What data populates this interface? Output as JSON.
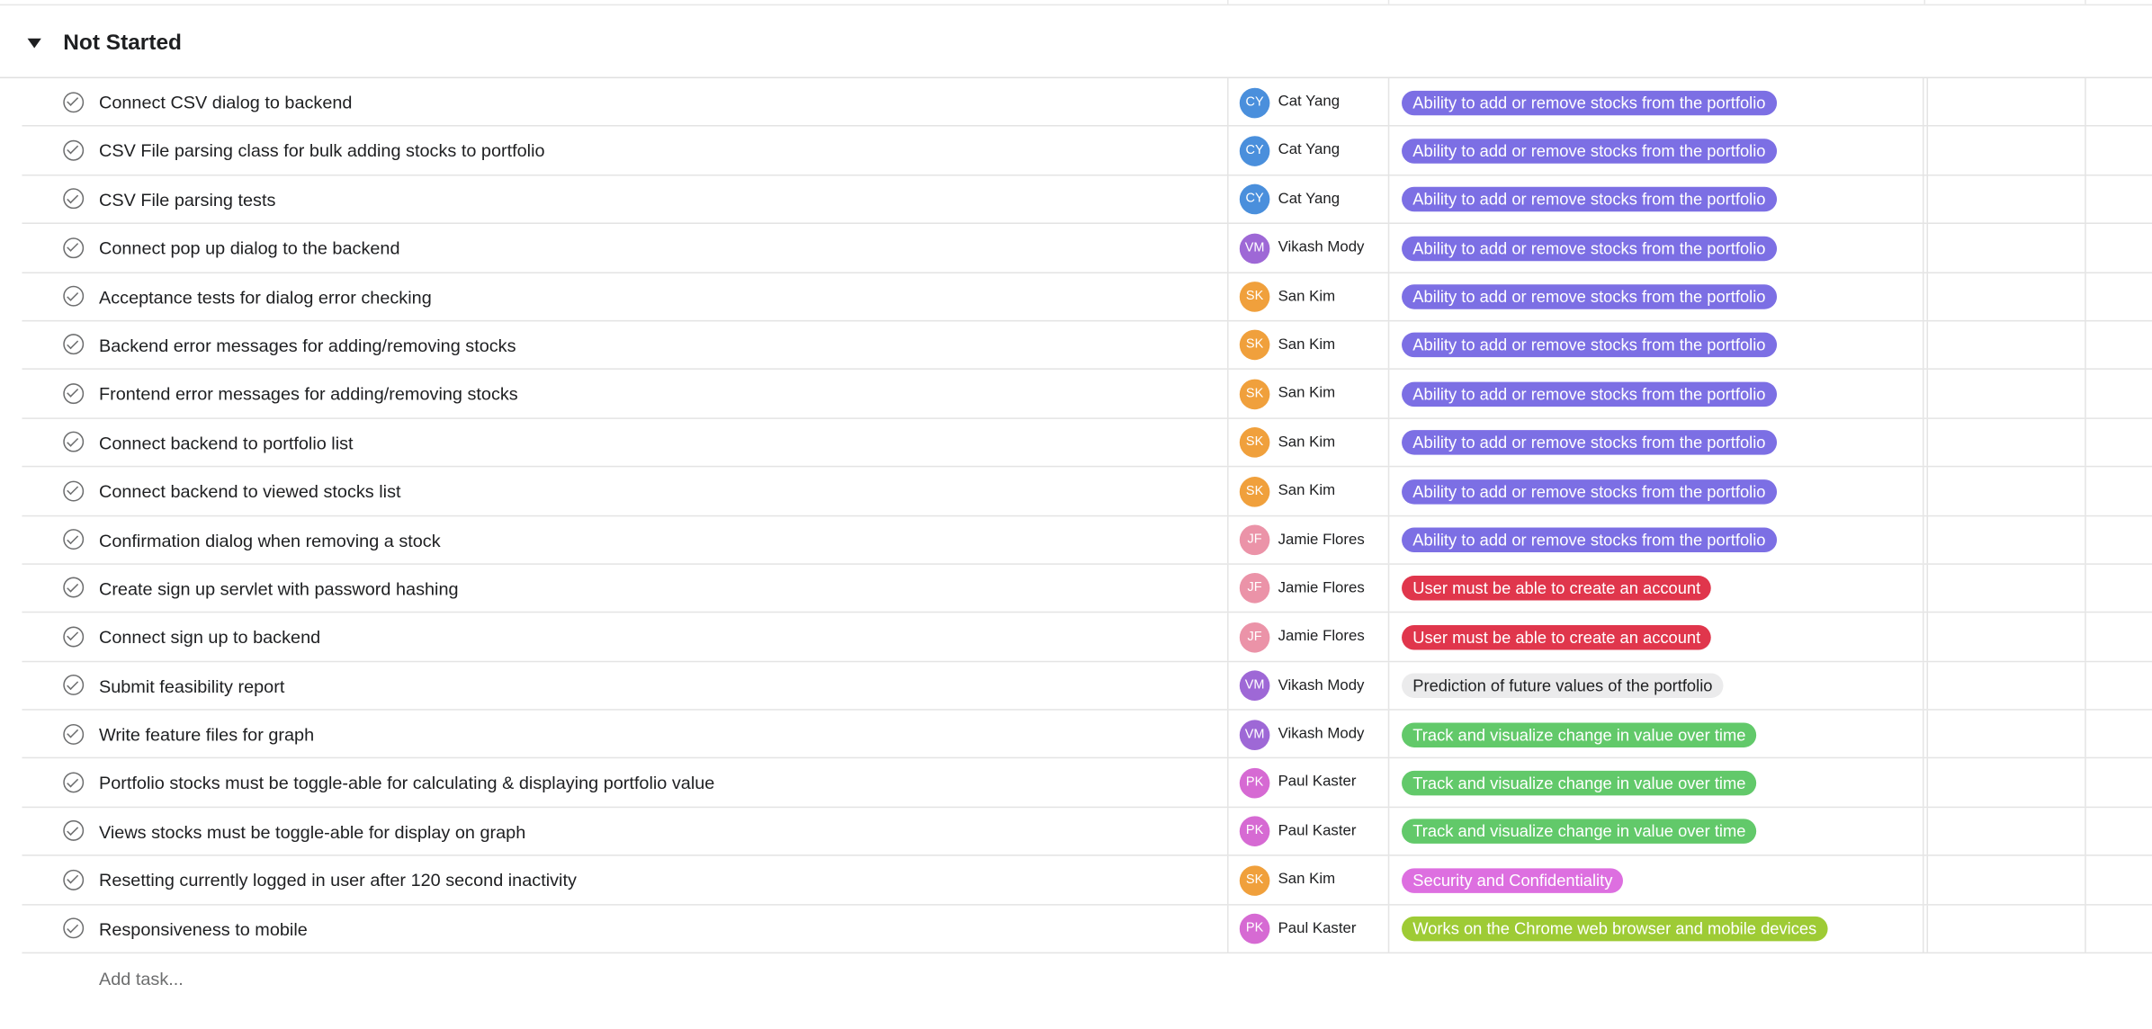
{
  "section": {
    "title": "Not Started"
  },
  "colors": {
    "avatar_cy": "#4a8fdc",
    "avatar_vm": "#9e68d6",
    "avatar_sk": "#f0a03c",
    "avatar_jf": "#eb93a8",
    "avatar_pk": "#d66ad3",
    "tag_portfolio": "#7c6fe4",
    "tag_account": "#e0364c",
    "tag_prediction": "#ebebec",
    "tag_track": "#62c96a",
    "tag_security": "#dd6fe0",
    "tag_chrome": "#9ecb35"
  },
  "tasks": [
    {
      "name": "Connect CSV dialog to backend",
      "initials": "CY",
      "assignee": "Cat Yang",
      "avatar_color": "#4a8fdc",
      "tag": "Ability to add or remove stocks from the portfolio",
      "tag_bg": "#7c6fe4",
      "tag_fg": "#ffffff"
    },
    {
      "name": "CSV File parsing class for bulk adding stocks to portfolio",
      "initials": "CY",
      "assignee": "Cat Yang",
      "avatar_color": "#4a8fdc",
      "tag": "Ability to add or remove stocks from the portfolio",
      "tag_bg": "#7c6fe4",
      "tag_fg": "#ffffff"
    },
    {
      "name": "CSV File parsing tests",
      "initials": "CY",
      "assignee": "Cat Yang",
      "avatar_color": "#4a8fdc",
      "tag": "Ability to add or remove stocks from the portfolio",
      "tag_bg": "#7c6fe4",
      "tag_fg": "#ffffff"
    },
    {
      "name": "Connect pop up dialog to the backend",
      "initials": "VM",
      "assignee": "Vikash Mody",
      "avatar_color": "#9e68d6",
      "tag": "Ability to add or remove stocks from the portfolio",
      "tag_bg": "#7c6fe4",
      "tag_fg": "#ffffff"
    },
    {
      "name": "Acceptance tests for dialog error checking",
      "initials": "SK",
      "assignee": "San Kim",
      "avatar_color": "#f0a03c",
      "tag": "Ability to add or remove stocks from the portfolio",
      "tag_bg": "#7c6fe4",
      "tag_fg": "#ffffff"
    },
    {
      "name": "Backend error messages for adding/removing stocks",
      "initials": "SK",
      "assignee": "San Kim",
      "avatar_color": "#f0a03c",
      "tag": "Ability to add or remove stocks from the portfolio",
      "tag_bg": "#7c6fe4",
      "tag_fg": "#ffffff"
    },
    {
      "name": "Frontend error messages for adding/removing stocks",
      "initials": "SK",
      "assignee": "San Kim",
      "avatar_color": "#f0a03c",
      "tag": "Ability to add or remove stocks from the portfolio",
      "tag_bg": "#7c6fe4",
      "tag_fg": "#ffffff"
    },
    {
      "name": "Connect backend to portfolio list",
      "initials": "SK",
      "assignee": "San Kim",
      "avatar_color": "#f0a03c",
      "tag": "Ability to add or remove stocks from the portfolio",
      "tag_bg": "#7c6fe4",
      "tag_fg": "#ffffff"
    },
    {
      "name": "Connect backend to viewed stocks list",
      "initials": "SK",
      "assignee": "San Kim",
      "avatar_color": "#f0a03c",
      "tag": "Ability to add or remove stocks from the portfolio",
      "tag_bg": "#7c6fe4",
      "tag_fg": "#ffffff"
    },
    {
      "name": "Confirmation dialog when removing a stock",
      "initials": "JF",
      "assignee": "Jamie Flores",
      "avatar_color": "#eb93a8",
      "tag": "Ability to add or remove stocks from the portfolio",
      "tag_bg": "#7c6fe4",
      "tag_fg": "#ffffff"
    },
    {
      "name": "Create sign up servlet with password hashing",
      "initials": "JF",
      "assignee": "Jamie Flores",
      "avatar_color": "#eb93a8",
      "tag": "User must be able to create an account",
      "tag_bg": "#e0364c",
      "tag_fg": "#ffffff"
    },
    {
      "name": "Connect sign up to backend",
      "initials": "JF",
      "assignee": "Jamie Flores",
      "avatar_color": "#eb93a8",
      "tag": "User must be able to create an account",
      "tag_bg": "#e0364c",
      "tag_fg": "#ffffff"
    },
    {
      "name": "Submit feasibility report",
      "initials": "VM",
      "assignee": "Vikash Mody",
      "avatar_color": "#9e68d6",
      "tag": "Prediction of future values of the portfolio",
      "tag_bg": "#ebebec",
      "tag_fg": "#1e1f21"
    },
    {
      "name": "Write feature files for graph",
      "initials": "VM",
      "assignee": "Vikash Mody",
      "avatar_color": "#9e68d6",
      "tag": "Track and visualize change in value over time",
      "tag_bg": "#62c96a",
      "tag_fg": "#ffffff"
    },
    {
      "name": "Portfolio stocks must be toggle-able for calculating & displaying portfolio value",
      "initials": "PK",
      "assignee": "Paul Kaster",
      "avatar_color": "#d66ad3",
      "tag": "Track and visualize change in value over time",
      "tag_bg": "#62c96a",
      "tag_fg": "#ffffff"
    },
    {
      "name": "Views stocks must be toggle-able for display on graph",
      "initials": "PK",
      "assignee": "Paul Kaster",
      "avatar_color": "#d66ad3",
      "tag": "Track and visualize change in value over time",
      "tag_bg": "#62c96a",
      "tag_fg": "#ffffff"
    },
    {
      "name": "Resetting currently logged in user after 120 second inactivity",
      "initials": "SK",
      "assignee": "San Kim",
      "avatar_color": "#f0a03c",
      "tag": "Security and Confidentiality",
      "tag_bg": "#dd6fe0",
      "tag_fg": "#ffffff"
    },
    {
      "name": "Responsiveness to mobile",
      "initials": "PK",
      "assignee": "Paul Kaster",
      "avatar_color": "#d66ad3",
      "tag": "Works on the Chrome web browser and mobile devices",
      "tag_bg": "#9ecb35",
      "tag_fg": "#ffffff"
    }
  ],
  "add_task": {
    "label": "Add task..."
  }
}
